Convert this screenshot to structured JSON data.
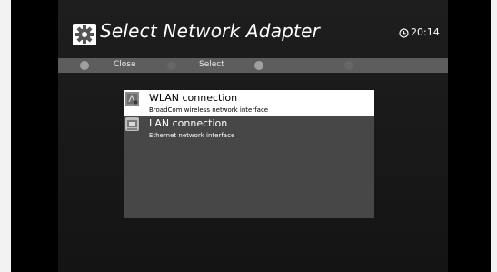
{
  "header": {
    "title": "Select Network Adapter",
    "clock": "20:14"
  },
  "button_bar": {
    "buttons": [
      {
        "label": "Close"
      },
      {
        "label": "Select"
      },
      {
        "label": ""
      },
      {
        "label": ""
      }
    ]
  },
  "adapter_list": {
    "items": [
      {
        "title": "WLAN connection",
        "subtitle": "BroadCom wireless network interface",
        "icon": "wireless-adapter-icon",
        "selected": true
      },
      {
        "title": "LAN connection",
        "subtitle": "Ethernet network interface",
        "icon": "ethernet-adapter-icon",
        "selected": false
      }
    ]
  },
  "colors": {
    "background": "#000000",
    "panel": "#474747",
    "button_bar": "#5d5d5d",
    "selection": "#ffffff"
  }
}
